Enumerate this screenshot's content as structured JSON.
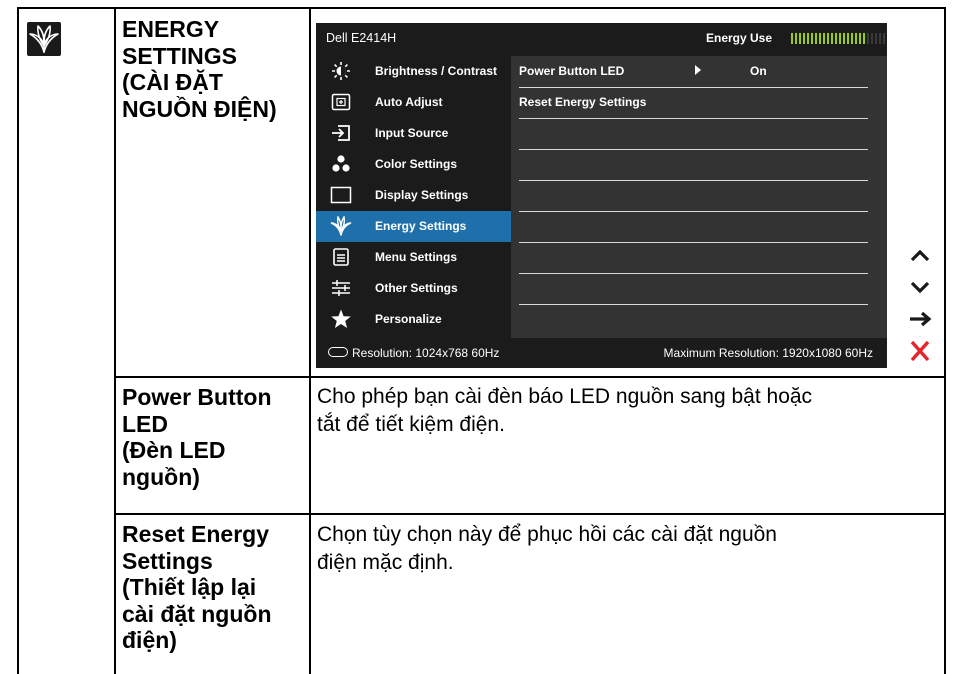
{
  "header": {
    "title_lines": [
      "ENERGY",
      "SETTINGS",
      "(CÀI ĐẶT",
      "NGUỒN ĐIỆN)"
    ]
  },
  "osd": {
    "model": "Dell E2414H",
    "energy_label": "Energy Use",
    "energy_level": 0.78,
    "menu_items": [
      {
        "label": "Brightness / Contrast",
        "icon": "brightness-icon"
      },
      {
        "label": "Auto Adjust",
        "icon": "auto-adjust-icon"
      },
      {
        "label": "Input Source",
        "icon": "input-source-icon"
      },
      {
        "label": "Color Settings",
        "icon": "color-settings-icon"
      },
      {
        "label": "Display Settings",
        "icon": "display-settings-icon"
      },
      {
        "label": "Energy Settings",
        "icon": "energy-settings-icon",
        "active": true
      },
      {
        "label": "Menu Settings",
        "icon": "menu-settings-icon"
      },
      {
        "label": "Other Settings",
        "icon": "other-settings-icon"
      },
      {
        "label": "Personalize",
        "icon": "personalize-icon"
      }
    ],
    "sub_items": [
      {
        "label": "Power Button LED",
        "value": "On"
      },
      {
        "label": "Reset Energy Settings",
        "value": ""
      }
    ],
    "resolution": "Resolution: 1024x768 60Hz",
    "max_resolution": "Maximum Resolution: 1920x1080 60Hz",
    "colors": {
      "active": "#1e6faa",
      "meter_on": "#9bcc1a",
      "close": "#e3242b"
    }
  },
  "nav_buttons": [
    "up-icon",
    "down-icon",
    "right-arrow-icon",
    "close-icon"
  ],
  "rows": [
    {
      "title_lines": [
        "Power Button",
        "LED",
        "(Đèn LED",
        "nguồn)"
      ],
      "description_lines": [
        "Cho phép bạn cài đèn báo LED nguồn sang bật hoặc",
        "tắt để tiết kiệm điện."
      ]
    },
    {
      "title_lines": [
        "Reset Energy",
        "Settings",
        "(Thiết lập lại",
        "cài đặt nguồn",
        "điện)"
      ],
      "description_lines": [
        "Chọn tùy chọn này để phục hồi các cài đặt nguồn",
        "điện mặc định."
      ]
    }
  ]
}
